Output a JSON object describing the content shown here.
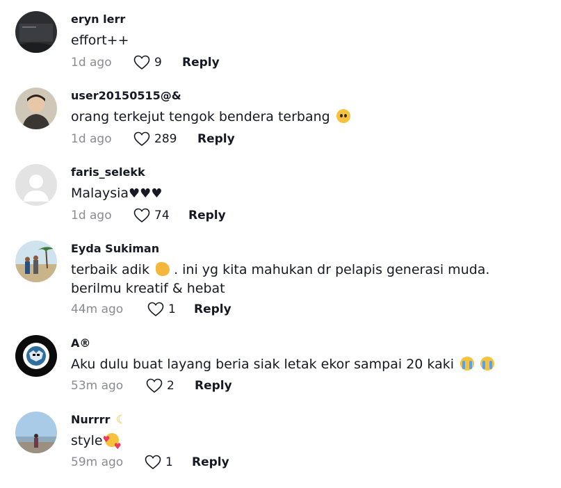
{
  "comments": [
    {
      "username": "eryn lerr",
      "text_lines": [
        "effort++"
      ],
      "time": "1d ago",
      "likes": "9",
      "reply_label": "Reply",
      "avatar": "dark-screen-avatar"
    },
    {
      "username": "user20150515@&",
      "text_lines": [
        "orang terkejut tengok bendera terbang"
      ],
      "emoji": [
        "pleading-face-emoji"
      ],
      "time": "1d ago",
      "likes": "289",
      "reply_label": "Reply",
      "avatar": "boy-photo-avatar"
    },
    {
      "username": "faris_selekk",
      "text_lines": [
        "Malaysia"
      ],
      "emoji": [
        "black-heart-emoji",
        "black-heart-emoji",
        "black-heart-emoji"
      ],
      "time": "1d ago",
      "likes": "74",
      "reply_label": "Reply",
      "avatar": "default-avatar"
    },
    {
      "username": "Eyda Sukiman",
      "text_lines": [
        "terbaik adik",
        ". ini yg kita mahukan dr pelapis generasi muda.",
        "berilmu kreatif & hebat"
      ],
      "emoji": [
        "flexed-biceps-emoji"
      ],
      "time": "44m ago",
      "likes": "1",
      "reply_label": "Reply",
      "avatar": "beach-family-avatar"
    },
    {
      "username": "A®",
      "text_lines": [
        "Aku dulu buat layang beria siak letak ekor sampai 20 kaki"
      ],
      "emoji": [
        "crying-face-emoji",
        "crying-face-emoji"
      ],
      "time": "53m ago",
      "likes": "2",
      "reply_label": "Reply",
      "avatar": "mask-logo-avatar"
    },
    {
      "username": "Nurrrr",
      "text_lines": [
        "style"
      ],
      "emoji": [
        "crescent-moon-emoji",
        "smiling-hearts-emoji"
      ],
      "time": "59m ago",
      "likes": "1",
      "reply_label": "Reply",
      "avatar": "sky-person-avatar"
    }
  ],
  "colors": {
    "text_primary": "#161823",
    "text_secondary": "#8a8b91"
  }
}
